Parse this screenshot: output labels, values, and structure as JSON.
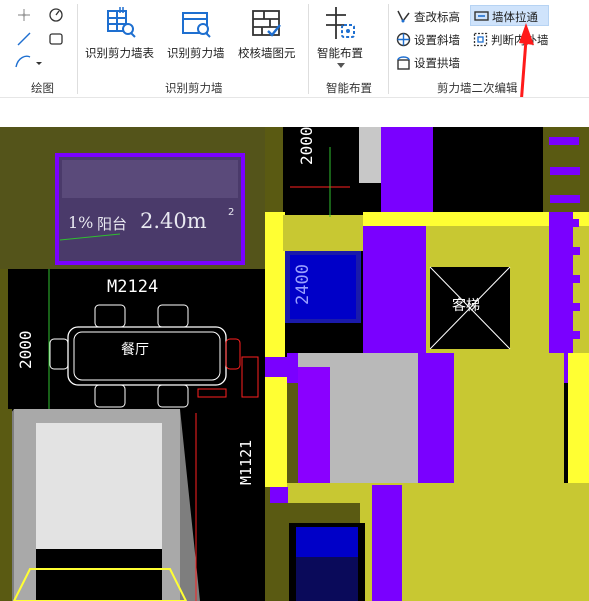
{
  "ribbon": {
    "draw_group": {
      "label": "绘图"
    },
    "identify_group": {
      "label": "识别剪力墙",
      "buttons": [
        "识别剪力墙表",
        "识别剪力墙",
        "校核墙图元"
      ]
    },
    "smart_group": {
      "label": "智能布置",
      "button": "智能布置"
    },
    "edit_group": {
      "label": "剪力墙二次编辑",
      "items": [
        "查改标高",
        "设置斜墙",
        "设置拱墙",
        "墙体拉通",
        "判断内外墙"
      ]
    }
  },
  "canvas": {
    "texts": {
      "balcony_pct": "1%",
      "balcony": "阳台",
      "balcony_size": "2.40m",
      "balcony_idx": "2",
      "door_m2124": "M2124",
      "dim_2000_left": "2000",
      "dim_2000_top": "2000",
      "dim_2400": "2400",
      "dining": "餐厅",
      "door_m1121": "M1121",
      "elevator": "客梯"
    }
  },
  "colors": {
    "wall_purple": "#7a00ff",
    "wall_yellow": "#c8c832",
    "highlight_yellow": "#ffff33",
    "wall_gray": "#bdbdbd",
    "olive": "#5a5a12",
    "annotation_red": "#ff2020",
    "selected": "#cfe3fb"
  },
  "icons": [
    "point-icon",
    "measure-icon",
    "line-icon",
    "rect-icon",
    "arc-icon",
    "table-icon",
    "wall-identify-icon",
    "check-wall-icon",
    "smart-place-icon",
    "elevation-icon",
    "slant-wall-icon",
    "arch-wall-icon",
    "wall-join-icon",
    "inner-outer-icon"
  ]
}
